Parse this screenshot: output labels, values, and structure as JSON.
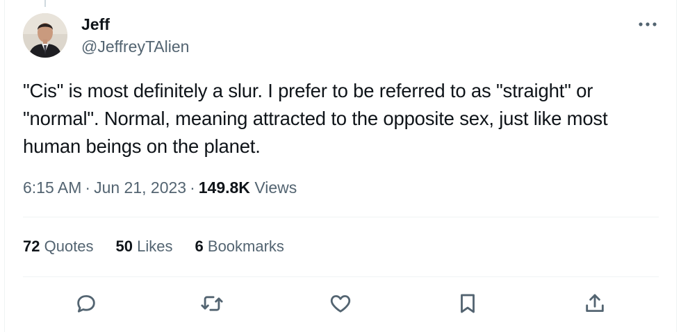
{
  "tweet": {
    "author": {
      "display_name": "Jeff",
      "handle": "@JeffreyTAlien"
    },
    "text": "\"Cis\" is most definitely a slur. I prefer to be referred to as \"straight\" or \"normal\". Normal, meaning attracted to the opposite sex, just like most human beings on the planet.",
    "time": "6:15 AM",
    "date": "Jun 21, 2023",
    "views_count": "149.8K",
    "views_label": "Views",
    "separator": "·"
  },
  "stats": [
    {
      "count": "72",
      "label": "Quotes"
    },
    {
      "count": "50",
      "label": "Likes"
    },
    {
      "count": "6",
      "label": "Bookmarks"
    }
  ],
  "icons": {
    "more": "more-options-icon",
    "reply": "reply-icon",
    "retweet": "retweet-icon",
    "like": "like-icon",
    "bookmark": "bookmark-icon",
    "share": "share-icon"
  },
  "colors": {
    "text_primary": "#0f1419",
    "text_secondary": "#536471",
    "divider": "#eff3f4"
  }
}
